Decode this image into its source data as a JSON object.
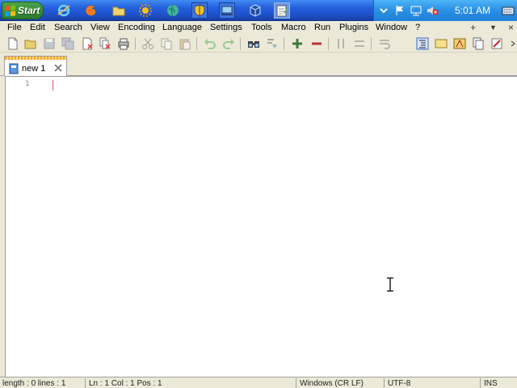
{
  "taskbar": {
    "start_label": "Start",
    "clock": "5:01 AM",
    "quicklaunch": [
      "ie-icon",
      "firefox-icon",
      "folder-icon",
      "sun-icon",
      "globe-icon",
      "shield-icon",
      "network-icon",
      "virtualbox-icon",
      "notepad-icon"
    ],
    "tray": [
      "chevron-down-icon",
      "flag-icon",
      "network-icon",
      "monitor-icon",
      "volume-muted-icon",
      "keyboard-icon"
    ]
  },
  "menubar": {
    "items": [
      "File",
      "Edit",
      "Search",
      "View",
      "Encoding",
      "Language",
      "Settings",
      "Tools",
      "Macro",
      "Run",
      "Plugins",
      "Window",
      "?"
    ],
    "right": [
      "+",
      "▼",
      "×"
    ]
  },
  "tabs": [
    {
      "label": "new 1",
      "close_icon": "close-icon"
    }
  ],
  "editor": {
    "line_numbers": [
      "1"
    ],
    "content": ""
  },
  "statusbar": {
    "length_lines": "length : 0    lines : 1",
    "position": "Ln : 1    Col : 1    Pos : 1",
    "eol": "Windows (CR LF)",
    "encoding": "UTF-8",
    "mode": "INS"
  },
  "colors": {
    "taskbar_blue": "#245edb",
    "start_green": "#3c8f3c",
    "tab_accent": "#f6a623",
    "caret": "#e05080"
  }
}
